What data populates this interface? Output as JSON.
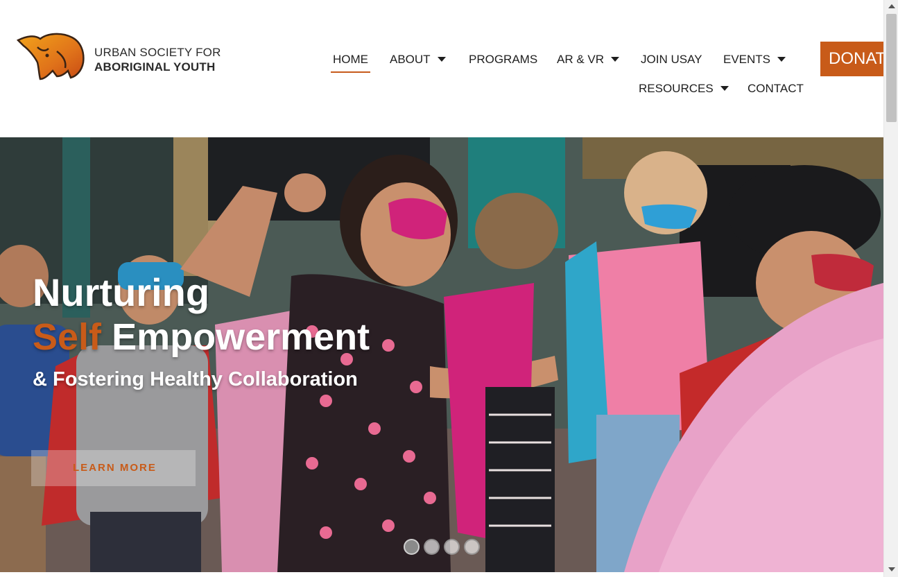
{
  "logo": {
    "icon": "bison-icon",
    "line1": "URBAN SOCIETY FOR",
    "line2": "ABORIGINAL YOUTH"
  },
  "nav": {
    "items": [
      {
        "label": "HOME",
        "active": true
      },
      {
        "label": "ABOUT",
        "dropdown": true
      },
      {
        "label": "PROGRAMS"
      },
      {
        "label": "AR & VR",
        "dropdown": true
      },
      {
        "label": "JOIN USAY"
      },
      {
        "label": "EVENTS",
        "dropdown": true
      },
      {
        "label": "RESOURCES",
        "dropdown": true
      },
      {
        "label": "CONTACT"
      }
    ],
    "donate_label": "DONATE"
  },
  "hero": {
    "title_line1": "Nurturing",
    "title_accent": "Self",
    "title_line2_rest": "Empowerment",
    "subtitle": "& Fostering Healthy Collaboration",
    "cta_label": "LEARN MORE",
    "slides_count": 4,
    "active_slide": 1
  },
  "colors": {
    "accent": "#c85b19",
    "text_dark": "#1e1e1e",
    "white": "#ffffff"
  }
}
